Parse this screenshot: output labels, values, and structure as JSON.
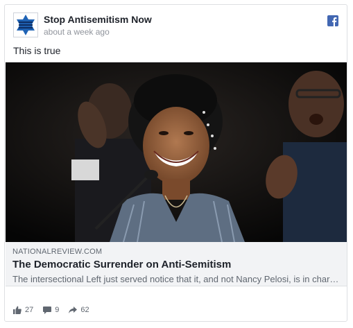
{
  "post": {
    "page_name": "Stop Antisemitism Now",
    "avatar_text": "STOP ANTISEMITISM NOW",
    "timestamp": "about a week ago",
    "text": "This is true",
    "icon": "facebook-icon"
  },
  "link_preview": {
    "domain": "NATIONALREVIEW.COM",
    "title": "The Democratic Surrender on Anti-Semitism",
    "description": "The intersectional Left just served notice that it, and not Nancy Pelosi, is in charge …"
  },
  "reactions": {
    "likes": "27",
    "comments": "9",
    "shares": "62"
  },
  "colors": {
    "facebook_blue": "#4267b2",
    "text_primary": "#1d2129",
    "text_secondary": "#606770",
    "meta": "#90949c"
  }
}
